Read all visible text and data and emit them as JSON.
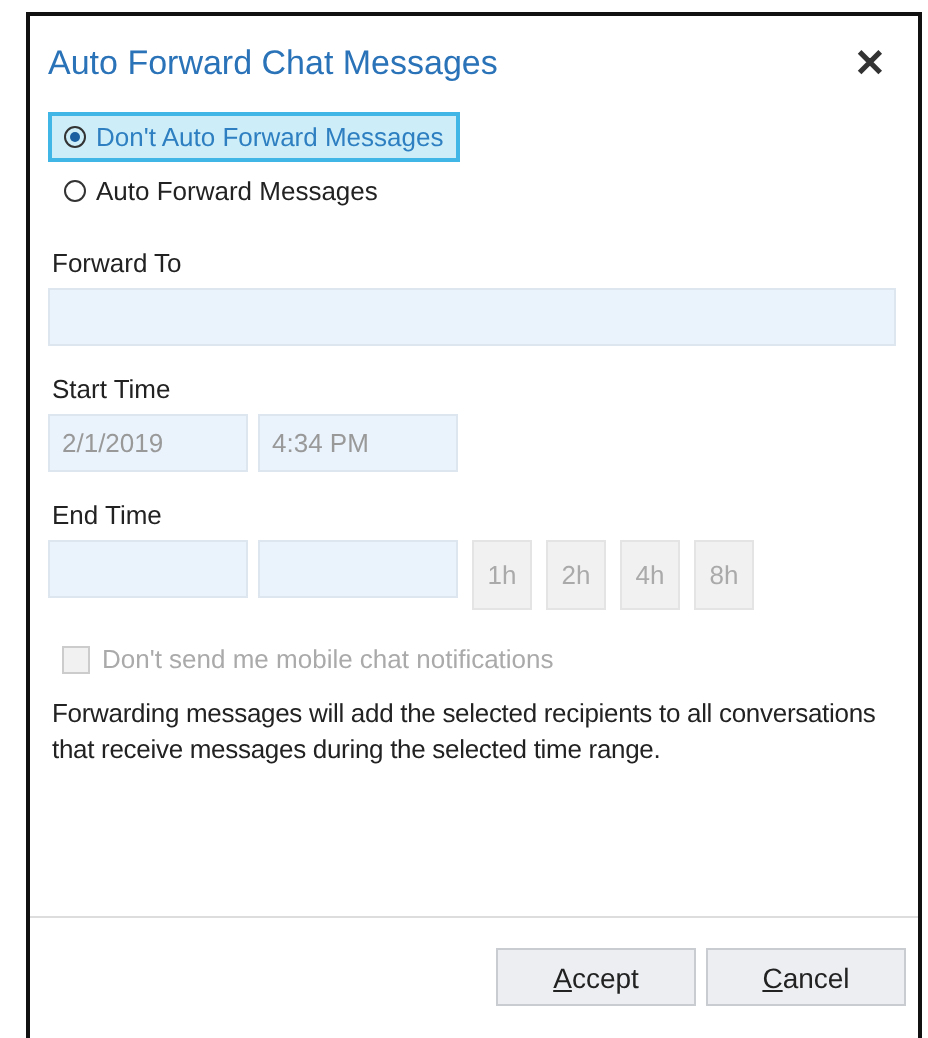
{
  "dialog": {
    "title": "Auto Forward Chat Messages",
    "close": "✕"
  },
  "options": [
    {
      "label": "Don't Auto Forward Messages",
      "selected": true
    },
    {
      "label": "Auto Forward Messages",
      "selected": false
    }
  ],
  "forward_to": {
    "label": "Forward To"
  },
  "start_time": {
    "label": "Start Time",
    "date": "2/1/2019",
    "time": "4:34 PM",
    "disabled": true
  },
  "end_time": {
    "label": "End Time",
    "presets": [
      {
        "label": "1h",
        "disabled": true
      },
      {
        "label": "2h",
        "disabled": true
      },
      {
        "label": "4h",
        "disabled": true
      },
      {
        "label": "8h",
        "disabled": true
      }
    ]
  },
  "mobile_notifications": {
    "label": "Don't send me mobile chat notifications",
    "checked": false,
    "disabled": true
  },
  "note": "Forwarding messages will add the selected recipients to all conversations that receive messages during the selected time range.",
  "buttons": [
    {
      "label": "Accept",
      "first_letter_underlined": true
    },
    {
      "label": "Cancel",
      "first_letter_underlined": true
    }
  ]
}
